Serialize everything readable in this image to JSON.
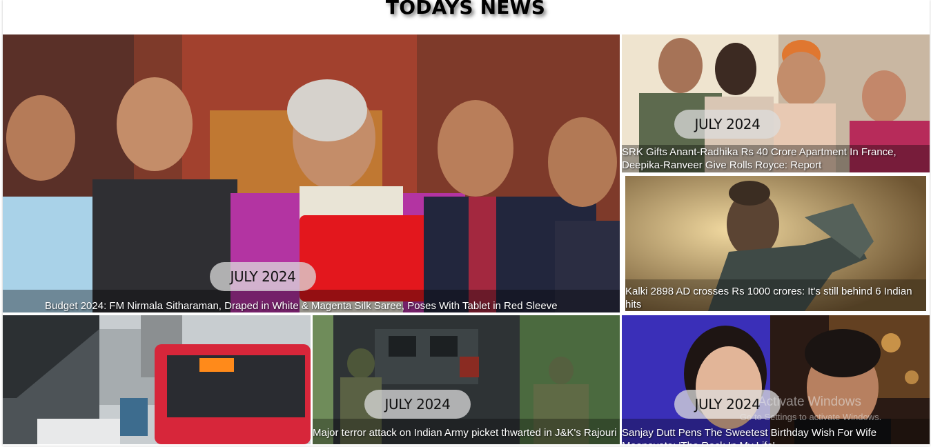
{
  "page": {
    "title": "TODAYS NEWS"
  },
  "cards": [
    {
      "badge": "JULY 2024",
      "caption": "Budget 2024: FM Nirmala Sitharaman, Draped in White & Magenta Silk Saree, Poses With Tablet in Red Sleeve"
    },
    {
      "badge": "JULY 2024",
      "caption": "SRK Gifts Anant-Radhika Rs 40 Crore Apartment In France, Deepika-Ranveer Give Rolls Royce: Report"
    },
    {
      "badge": "",
      "caption": "Kalki 2898 AD crosses Rs 1000 crores: It's still behind 6 Indian hits"
    },
    {
      "badge": "",
      "caption": ""
    },
    {
      "badge": "JULY 2024",
      "caption": "Major terror attack on Indian Army picket thwarted in J&K's Rajouri"
    },
    {
      "badge": "JULY 2024",
      "caption": "Sanjay Dutt Pens The Sweetest Birthday Wish For Wife Maanayata: 'The Rock In My Life'"
    }
  ],
  "overlay": {
    "line1": "Activate Windows",
    "line2": "Go to Settings to activate Windows."
  }
}
